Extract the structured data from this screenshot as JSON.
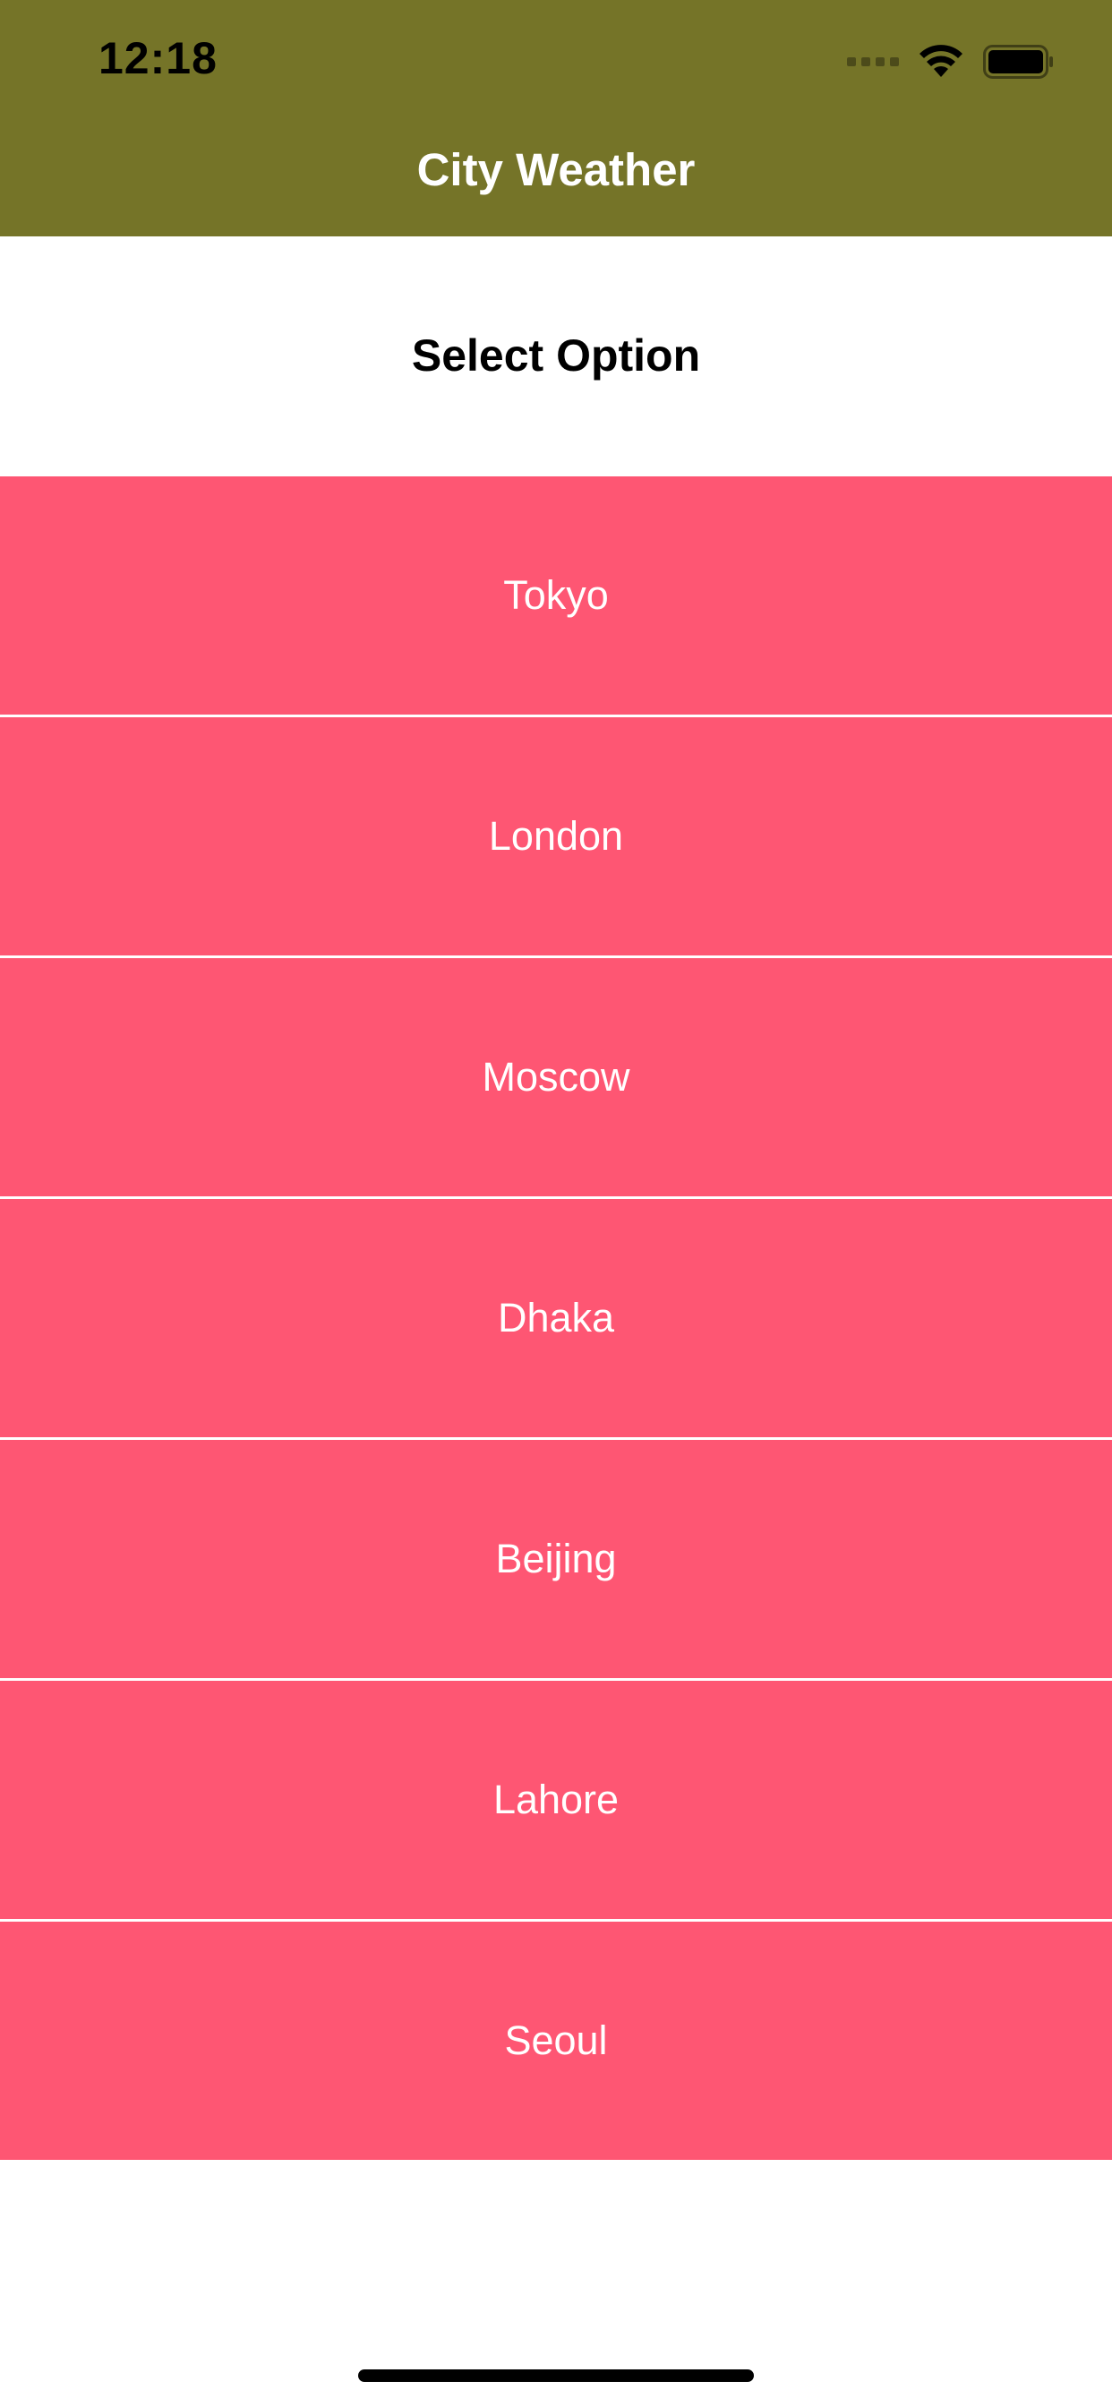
{
  "status_bar": {
    "time": "12:18",
    "icons": [
      "cellular-signal-icon",
      "wifi-icon",
      "battery-icon"
    ]
  },
  "nav_bar": {
    "title": "City Weather",
    "background": "#757428"
  },
  "section": {
    "title": "Select Option"
  },
  "city_list": {
    "item_color": "#fe5673",
    "items": [
      {
        "label": "Tokyo"
      },
      {
        "label": "London"
      },
      {
        "label": "Moscow"
      },
      {
        "label": "Dhaka"
      },
      {
        "label": "Beijing"
      },
      {
        "label": "Lahore"
      },
      {
        "label": "Seoul"
      }
    ]
  }
}
